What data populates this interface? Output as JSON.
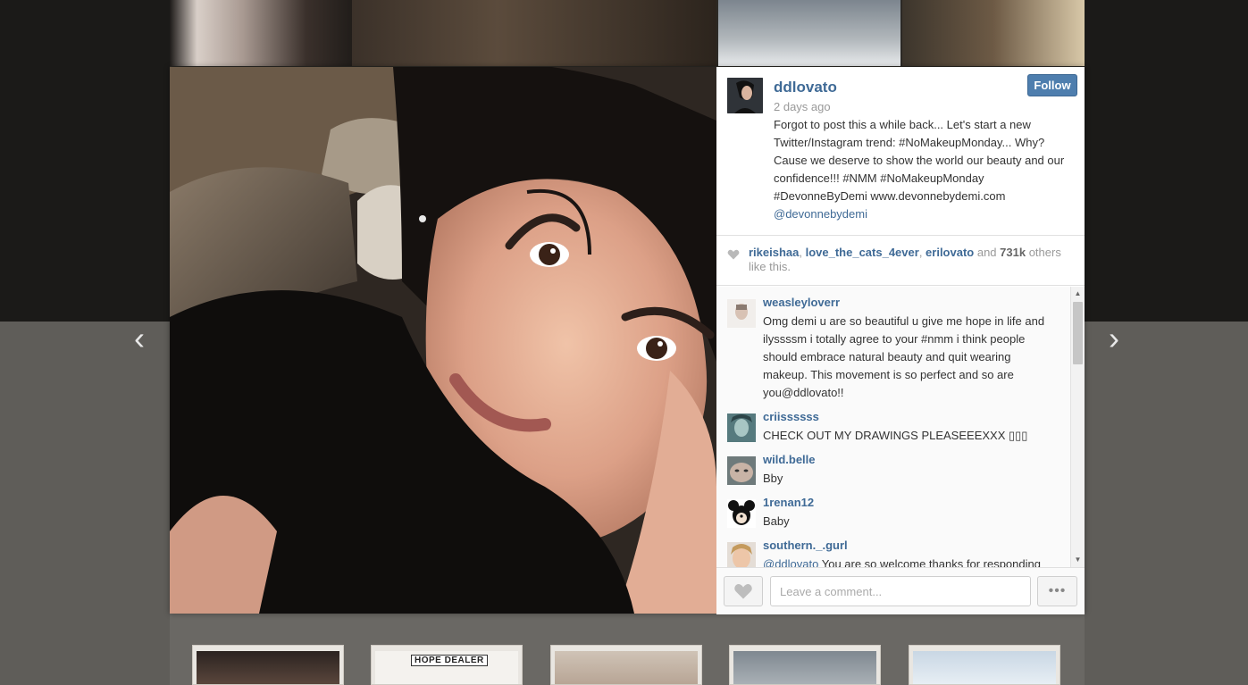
{
  "post": {
    "username": "ddlovato",
    "time_ago": "2 days ago",
    "follow_label": "Follow",
    "caption_text": "Forgot to post this a while back... Let's start a new Twitter/Instagram trend: #NoMakeupMonday... Why? Cause we deserve to show the world our beauty and our confidence!!! #NMM #NoMakeupMonday #DevonneByDemi www.devonnebydemi.com",
    "caption_mention": "@devonnebydemi"
  },
  "likes": {
    "user1": "rikeishaa",
    "sep1": ", ",
    "user2": "love_the_cats_4ever",
    "sep2": ", ",
    "user3": "erilovato",
    "and": " and ",
    "count": "731k",
    "suffix": " others like this."
  },
  "comments": [
    {
      "user": "weasleyloverr",
      "text": "Omg demi u are so beautiful u give me hope in life and ilyssssm i totally agree to your #nmm i think people should embrace natural beauty and quit wearing makeup. This movement is so perfect and so are you@ddlovato!!"
    },
    {
      "user": "criissssss",
      "text": "CHECK OUT MY DRAWINGS PLEASEEEXXX ▯▯▯"
    },
    {
      "user": "wild.belle",
      "text": "Bby"
    },
    {
      "user": "1renan12",
      "text": "Baby"
    },
    {
      "user": "southern._.gurl",
      "mention": "@ddlovato",
      "text": " You are so welcome thanks for responding"
    }
  ],
  "footer": {
    "comment_placeholder": "Leave a comment...",
    "more_label": "•••"
  },
  "nav": {
    "prev": "‹",
    "next": "›"
  },
  "background": {
    "hope_dealer_label": "HOPE DEALER"
  }
}
